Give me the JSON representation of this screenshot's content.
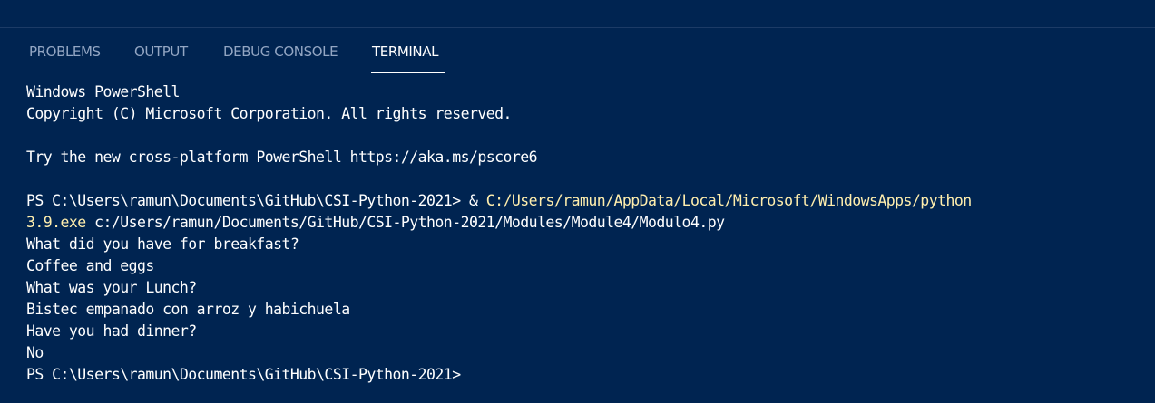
{
  "panel": {
    "tabs": [
      {
        "label": "PROBLEMS",
        "active": false
      },
      {
        "label": "OUTPUT",
        "active": false
      },
      {
        "label": "DEBUG CONSOLE",
        "active": false
      },
      {
        "label": "TERMINAL",
        "active": true
      }
    ]
  },
  "terminal": {
    "lines": [
      {
        "text": "Windows PowerShell"
      },
      {
        "text": "Copyright (C) Microsoft Corporation. All rights reserved."
      },
      {
        "text": ""
      },
      {
        "text": "Try the new cross-platform PowerShell https://aka.ms/pscore6"
      },
      {
        "text": ""
      },
      {
        "prompt": "PS C:\\Users\\ramun\\Documents\\GitHub\\CSI-Python-2021> & ",
        "highlight": "C:/Users/ramun/AppData/Local/Microsoft/WindowsApps/python"
      },
      {
        "highlight": "3.9.exe",
        "text": " c:/Users/ramun/Documents/GitHub/CSI-Python-2021/Modules/Module4/Modulo4.py"
      },
      {
        "text": "What did you have for breakfast?"
      },
      {
        "text": "Coffee and eggs"
      },
      {
        "text": "What was your Lunch?"
      },
      {
        "text": "Bistec empanado con arroz y habichuela"
      },
      {
        "text": "Have you had dinner?"
      },
      {
        "text": "No"
      },
      {
        "text": "PS C:\\Users\\ramun\\Documents\\GitHub\\CSI-Python-2021>"
      }
    ]
  },
  "colors": {
    "background": "#002451",
    "text": "#ffffff",
    "command_highlight": "#ffeead",
    "inactive_tab": "#93a6c3"
  }
}
